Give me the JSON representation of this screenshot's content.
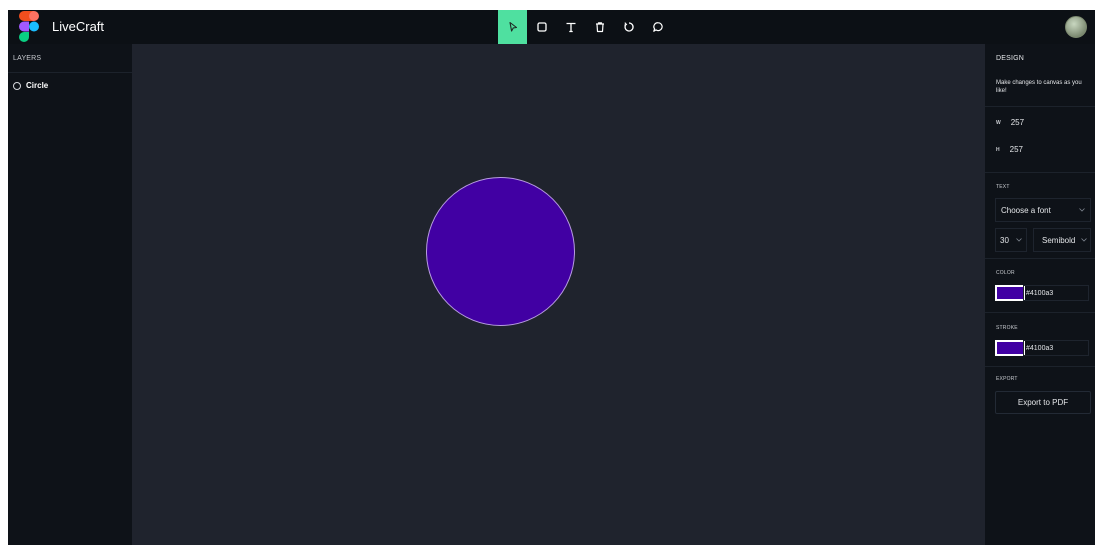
{
  "app": {
    "title": "LiveCraft"
  },
  "toolbar": {
    "tools": [
      {
        "name": "select-tool",
        "icon": "cursor-arrow-icon",
        "active": true
      },
      {
        "name": "rectangle-tool",
        "icon": "square-icon",
        "active": false
      },
      {
        "name": "text-tool",
        "icon": "text-t-icon",
        "active": false
      },
      {
        "name": "delete-tool",
        "icon": "trash-icon",
        "active": false
      },
      {
        "name": "reset-tool",
        "icon": "rotate-icon",
        "active": false
      },
      {
        "name": "comment-tool",
        "icon": "chat-bubble-icon",
        "active": false
      }
    ],
    "accent": "#4fe0a0"
  },
  "layers": {
    "heading": "LAYERS",
    "items": [
      {
        "label": "Circle",
        "icon": "circle-outline-icon"
      }
    ]
  },
  "canvas": {
    "shape": {
      "type": "circle",
      "fill": "#4100a3",
      "stroke": "#b79be0"
    }
  },
  "design": {
    "heading": "DESIGN",
    "description": "Make changes to canvas as you like!",
    "width_label": "W",
    "width_value": "257",
    "height_label": "H",
    "height_value": "257",
    "text_heading": "TEXT",
    "font_placeholder": "Choose a font",
    "font_size": "30",
    "font_weight": "Semibold",
    "color_heading": "COLOR",
    "color_value": "#4100a3",
    "stroke_heading": "STROKE",
    "stroke_value": "#4100a3",
    "export_heading": "EXPORT",
    "export_label": "Export to PDF"
  }
}
